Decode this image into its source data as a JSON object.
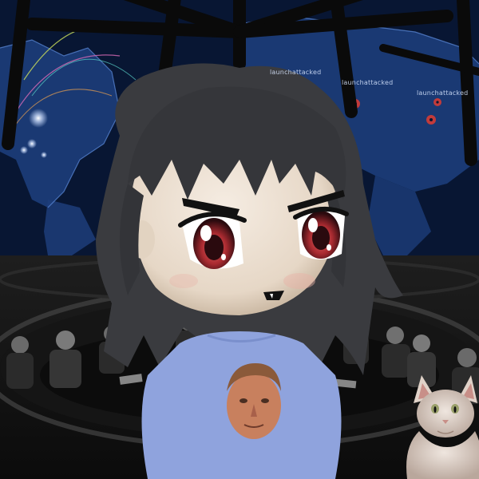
{
  "scene": {
    "map_labels": [
      "launchattacked",
      "launchattacked",
      "launchattacked"
    ],
    "colors": {
      "map_ocean": "#0a1a3a",
      "map_land": "#1d3d7a",
      "map_glow": "#5f8ee0",
      "table_dark": "#1a1a1a",
      "shirt_blue": "#8fa3dd",
      "hair": "#3a3b3f",
      "skin": "#efe4d6",
      "eye_red": "#b0343a"
    },
    "icons": [
      "nuclear-hazard-icon",
      "nuclear-hazard-icon",
      "nuclear-hazard-icon"
    ]
  }
}
